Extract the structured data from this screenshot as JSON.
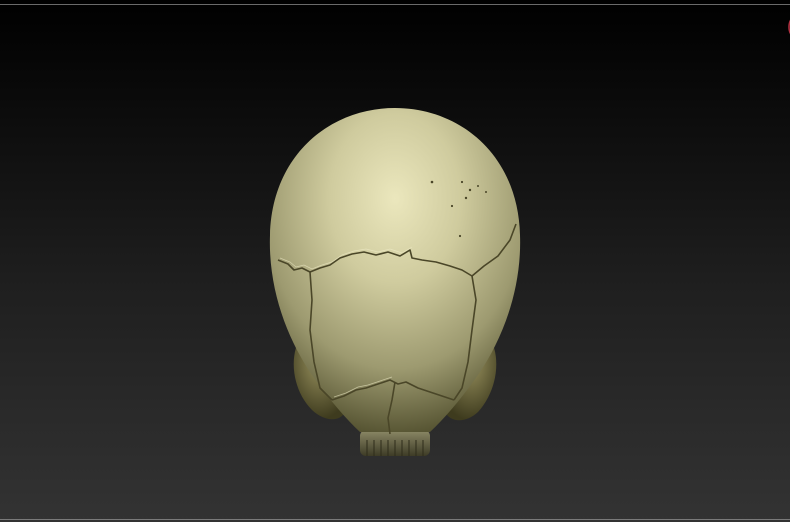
{
  "viewport": {
    "background_top": "#000000",
    "background_bottom": "#333333",
    "frame_line_color": "#6a6a6a"
  },
  "model": {
    "icon": "skull-model",
    "base_color": "#e6e2b8",
    "shadow_color": "#5a5832",
    "suture_color": "#4a4628"
  },
  "indicators": {
    "corner_icon": "circle-indicator-icon",
    "corner_color": "#b03040"
  }
}
